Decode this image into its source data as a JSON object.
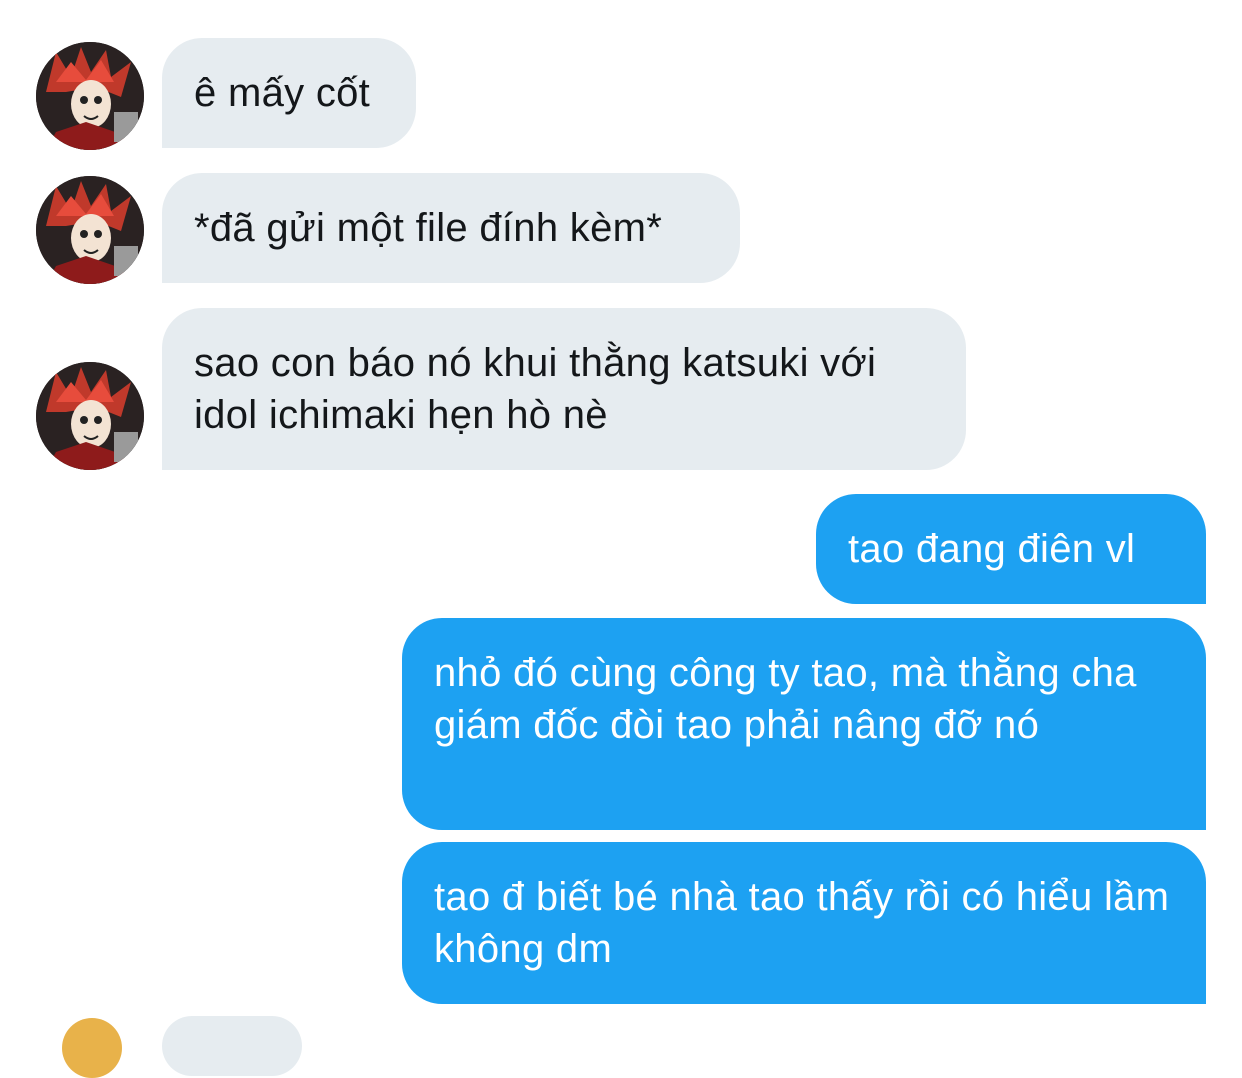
{
  "conversation": {
    "messages": [
      {
        "sender": "other",
        "text": "ê mấy cốt"
      },
      {
        "sender": "other",
        "text": "*đã gửi một file đính kèm*"
      },
      {
        "sender": "other",
        "text": "sao con báo nó khui thằng katsuki với idol ichimaki hẹn hò nè"
      },
      {
        "sender": "me",
        "text": "tao đang điên vl"
      },
      {
        "sender": "me",
        "text": "nhỏ đó cùng công ty tao, mà thằng cha giám đốc đòi tao phải nâng đỡ nó"
      },
      {
        "sender": "me",
        "text": "tao đ biết bé nhà tao thấy rồi có hiểu lầm không dm"
      }
    ]
  },
  "colors": {
    "incoming_bubble": "#e6ecf0",
    "incoming_text": "#14171a",
    "outgoing_bubble": "#1da1f2",
    "outgoing_text": "#ffffff"
  },
  "icons": {
    "avatar": "red-spiky-hair-character-avatar"
  }
}
